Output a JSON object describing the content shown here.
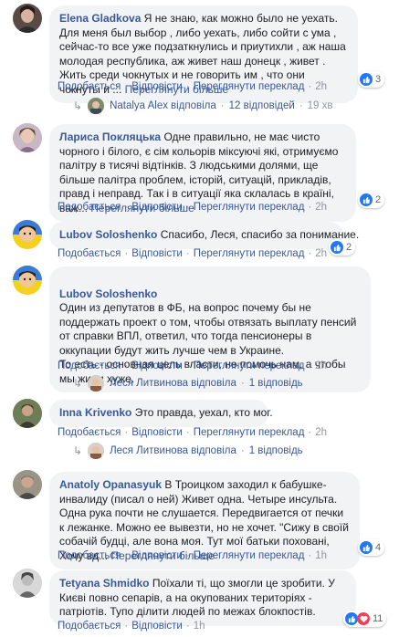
{
  "labels": {
    "like": "Подобається",
    "reply": "Відповісти",
    "see_translation": "Переглянути переклад",
    "see_more": "Переглянути більше",
    "dot": "·"
  },
  "comments": [
    {
      "author": "Elena Gladkova",
      "text": "Я не знаю, как можно было не уехать. Для меня был выбор , либо уехать, либо сойти с ума , сейчас-то все уже подзаткнулись и приутихли , аж наша молодая республика, аж живет наш донецк , живет . Жить среди чокнутых и не говорить им , что они чокнуты и ...",
      "time": "2h",
      "reactions": "3"
    },
    {
      "author": "Лариса Покляцька",
      "text": "Одне правильно, не має чисто чорного і білого, є сім кольорів міксуючі які, отримуємо палітру в тисячі відтінків. З людськими долями, ще більше палітра проблем, історій, ситуацій, прикладів, правд і неправд. Так і в ситуації яка склалась в країні, важ...",
      "time": "2h",
      "reactions": "2"
    },
    {
      "author": "Lubov Soloshenko",
      "text": "Спасибо, Леся, спасибо за понимание.",
      "time": "2h",
      "reactions": "2"
    },
    {
      "author": "Lubov Soloshenko",
      "text": "Один из депутатов в ФБ, на вопрос почему бы не поддержать проект о том, чтобы отвязать выплату пенсий от справки ВПЛ, ответил, что тогда пенсионеры в оккупации будут жить лучше чем в Украине.\nТо есть - основная цель власти, не помочь нам, а чтобы мы жили хуже.",
      "time": "2h"
    },
    {
      "author": "Inna Krivenko",
      "text": "Это правда, уехал, кто мог.",
      "time": "2h"
    },
    {
      "author": "Anatoly Opanasyuk",
      "text": "В Троицком заходил к бабушке-инвалиду (писал о ней) Живет одна. Четыре инсульта. Одна рука почти не слушается. Передвигается от печки к лежанке. Можно ее вывезти, но не хочет. \"Сижу в своїй собачій будці, але вона моя. Тут мої батьки поховані, Хочу вд...",
      "time": "1h",
      "reactions": "4"
    },
    {
      "author": "Tetyana Shmidko",
      "text": "Поїхали ті, що змогли це зробити. У Києві повно сепарів, а на окупованих територіях - патріотів. Тупо ділити людей по межах блокпостів.",
      "time": "1h",
      "reactions": "11"
    }
  ],
  "replies": [
    {
      "name": "Natalya Alex",
      "verb": "відповіла",
      "count": "12 відповідей",
      "time": "19 хв"
    },
    {
      "name": "Леся Литвинова",
      "verb": "відповіла",
      "count": "1 відповідь"
    },
    {
      "name": "Леся Литвинова",
      "verb": "відповіла",
      "count": "1 відповідь"
    }
  ],
  "colors": {
    "link": "#385898",
    "bubble": "#f2f3f5",
    "meta": "#90949c",
    "like": "#2078f4",
    "love": "#f33e58"
  }
}
